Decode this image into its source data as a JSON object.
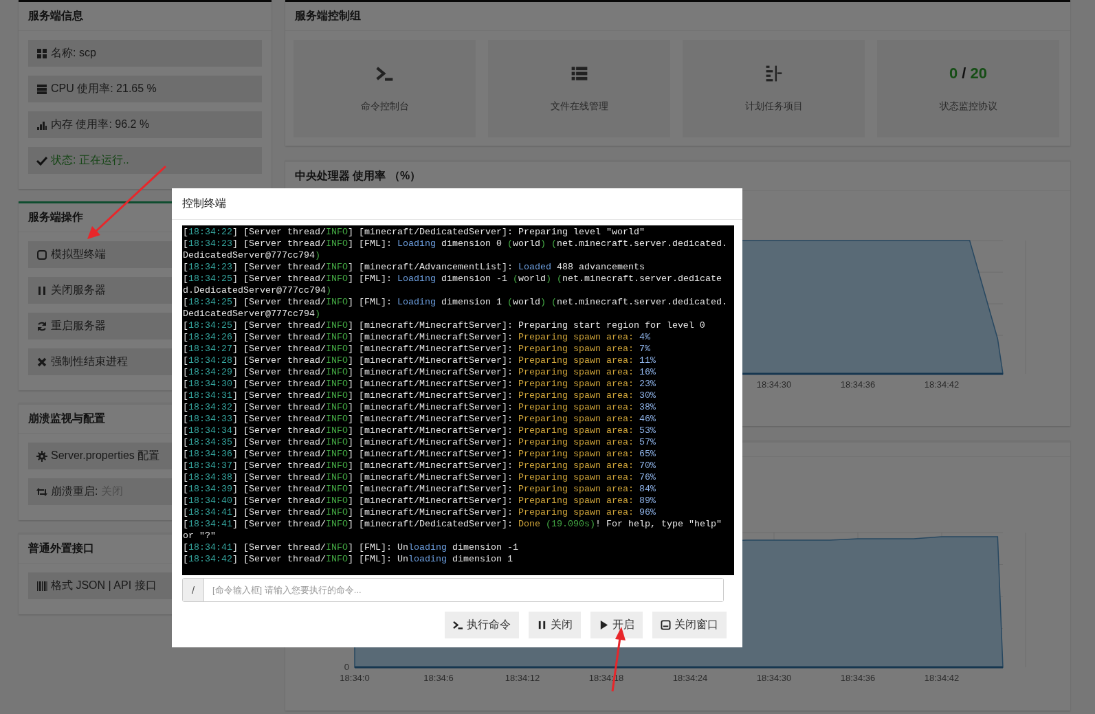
{
  "sidebar": {
    "panels": [
      {
        "title": "服务端信息",
        "items": [
          {
            "text": "名称: scp"
          },
          {
            "text": "CPU 使用率: 21.65 %"
          },
          {
            "text": "内存 使用率: 96.2 %"
          },
          {
            "text": "状态: 正在运行..",
            "kind": "status"
          }
        ]
      },
      {
        "title": "服务端操作",
        "items": [
          {
            "text": "模拟型终端"
          },
          {
            "text": "关闭服务器"
          },
          {
            "text": "重启服务器"
          },
          {
            "text": "强制性结束进程"
          }
        ]
      },
      {
        "title": "崩溃监视与配置",
        "items": [
          {
            "text": "Server.properties 配置"
          },
          {
            "text": "崩溃重启:",
            "value": "关闭"
          }
        ]
      },
      {
        "title": "普通外置接口",
        "items": [
          {
            "text": "格式 JSON | API 接口"
          }
        ]
      }
    ]
  },
  "control_group": {
    "title": "服务端控制组",
    "tiles": [
      {
        "kind": "icon",
        "label": "命令控制台"
      },
      {
        "kind": "icon",
        "label": "文件在线管理"
      },
      {
        "kind": "icon",
        "label": "计划任务项目"
      },
      {
        "kind": "counter",
        "current": "0",
        "separator": "/",
        "total": "20",
        "label": "状态监控协议"
      }
    ]
  },
  "cpu_chart": {
    "title": "中央处理器 使用率 （%）",
    "x_ticks": [
      "18:34:30",
      "18:34:36",
      "18:34:42"
    ]
  },
  "memory_chart": {
    "y_ticks": [
      "0"
    ],
    "x_ticks": [
      "18:34:0",
      "18:34:6",
      "18:34:12",
      "18:34:18",
      "18:34:24",
      "18:34:30",
      "18:34:36",
      "18:34:42"
    ]
  },
  "modal": {
    "title": "控制终端",
    "log_lines": [
      [
        {
          "text": "[",
          "kind": "plain"
        },
        {
          "text": "18:34:22",
          "kind": "time"
        },
        {
          "text": "] [Server thread/",
          "kind": "plain"
        },
        {
          "text": "INFO",
          "kind": "level"
        },
        {
          "text": "] [minecraft/DedicatedServer]: Preparing level \"world\"",
          "kind": "plain"
        }
      ],
      [
        {
          "text": "[",
          "kind": "plain"
        },
        {
          "text": "18:34:23",
          "kind": "time"
        },
        {
          "text": "] [Server thread/",
          "kind": "plain"
        },
        {
          "text": "INFO",
          "kind": "level"
        },
        {
          "text": "] [FML]: ",
          "kind": "plain"
        },
        {
          "text": "Loading",
          "kind": "keyword"
        },
        {
          "text": " dimension 0 ",
          "kind": "plain"
        },
        {
          "text": "(",
          "kind": "paren"
        },
        {
          "text": "world",
          "kind": "plain"
        },
        {
          "text": ") (",
          "kind": "paren"
        },
        {
          "text": "net.minecraft.server.dedicated.DedicatedServer@777cc794",
          "kind": "plain"
        },
        {
          "text": ")",
          "kind": "paren"
        }
      ],
      [
        {
          "text": "[",
          "kind": "plain"
        },
        {
          "text": "18:34:23",
          "kind": "time"
        },
        {
          "text": "] [Server thread/",
          "kind": "plain"
        },
        {
          "text": "INFO",
          "kind": "level"
        },
        {
          "text": "] [minecraft/AdvancementList]: ",
          "kind": "plain"
        },
        {
          "text": "Loaded",
          "kind": "keyword"
        },
        {
          "text": " 488 advancements",
          "kind": "plain"
        }
      ],
      [
        {
          "text": "[",
          "kind": "plain"
        },
        {
          "text": "18:34:25",
          "kind": "time"
        },
        {
          "text": "] [Server thread/",
          "kind": "plain"
        },
        {
          "text": "INFO",
          "kind": "level"
        },
        {
          "text": "] [FML]: ",
          "kind": "plain"
        },
        {
          "text": "Loading",
          "kind": "keyword"
        },
        {
          "text": " dimension -1 ",
          "kind": "plain"
        },
        {
          "text": "(",
          "kind": "paren"
        },
        {
          "text": "world",
          "kind": "plain"
        },
        {
          "text": ") (",
          "kind": "paren"
        },
        {
          "text": "net.minecraft.server.dedicated.DedicatedServer@777cc794",
          "kind": "plain"
        },
        {
          "text": ")",
          "kind": "paren"
        }
      ],
      [
        {
          "text": "[",
          "kind": "plain"
        },
        {
          "text": "18:34:25",
          "kind": "time"
        },
        {
          "text": "] [Server thread/",
          "kind": "plain"
        },
        {
          "text": "INFO",
          "kind": "level"
        },
        {
          "text": "] [FML]: ",
          "kind": "plain"
        },
        {
          "text": "Loading",
          "kind": "keyword"
        },
        {
          "text": " dimension 1 ",
          "kind": "plain"
        },
        {
          "text": "(",
          "kind": "paren"
        },
        {
          "text": "world",
          "kind": "plain"
        },
        {
          "text": ") (",
          "kind": "paren"
        },
        {
          "text": "net.minecraft.server.dedicated.DedicatedServer@777cc794",
          "kind": "plain"
        },
        {
          "text": ")",
          "kind": "paren"
        }
      ],
      [
        {
          "text": "[",
          "kind": "plain"
        },
        {
          "text": "18:34:25",
          "kind": "time"
        },
        {
          "text": "] [Server thread/",
          "kind": "plain"
        },
        {
          "text": "INFO",
          "kind": "level"
        },
        {
          "text": "] [minecraft/MinecraftServer]: Preparing start region for level 0",
          "kind": "plain"
        }
      ],
      [
        {
          "text": "[",
          "kind": "plain"
        },
        {
          "text": "18:34:26",
          "kind": "time"
        },
        {
          "text": "] [Server thread/",
          "kind": "plain"
        },
        {
          "text": "INFO",
          "kind": "level"
        },
        {
          "text": "] [minecraft/MinecraftServer]: ",
          "kind": "plain"
        },
        {
          "text": "Preparing spawn area:",
          "kind": "progress"
        },
        {
          "text": " 4%",
          "kind": "number"
        }
      ],
      [
        {
          "text": "[",
          "kind": "plain"
        },
        {
          "text": "18:34:27",
          "kind": "time"
        },
        {
          "text": "] [Server thread/",
          "kind": "plain"
        },
        {
          "text": "INFO",
          "kind": "level"
        },
        {
          "text": "] [minecraft/MinecraftServer]: ",
          "kind": "plain"
        },
        {
          "text": "Preparing spawn area:",
          "kind": "progress"
        },
        {
          "text": " 7%",
          "kind": "number"
        }
      ],
      [
        {
          "text": "[",
          "kind": "plain"
        },
        {
          "text": "18:34:28",
          "kind": "time"
        },
        {
          "text": "] [Server thread/",
          "kind": "plain"
        },
        {
          "text": "INFO",
          "kind": "level"
        },
        {
          "text": "] [minecraft/MinecraftServer]: ",
          "kind": "plain"
        },
        {
          "text": "Preparing spawn area:",
          "kind": "progress"
        },
        {
          "text": " 11%",
          "kind": "number"
        }
      ],
      [
        {
          "text": "[",
          "kind": "plain"
        },
        {
          "text": "18:34:29",
          "kind": "time"
        },
        {
          "text": "] [Server thread/",
          "kind": "plain"
        },
        {
          "text": "INFO",
          "kind": "level"
        },
        {
          "text": "] [minecraft/MinecraftServer]: ",
          "kind": "plain"
        },
        {
          "text": "Preparing spawn area:",
          "kind": "progress"
        },
        {
          "text": " 16%",
          "kind": "number"
        }
      ],
      [
        {
          "text": "[",
          "kind": "plain"
        },
        {
          "text": "18:34:30",
          "kind": "time"
        },
        {
          "text": "] [Server thread/",
          "kind": "plain"
        },
        {
          "text": "INFO",
          "kind": "level"
        },
        {
          "text": "] [minecraft/MinecraftServer]: ",
          "kind": "plain"
        },
        {
          "text": "Preparing spawn area:",
          "kind": "progress"
        },
        {
          "text": " 23%",
          "kind": "number"
        }
      ],
      [
        {
          "text": "[",
          "kind": "plain"
        },
        {
          "text": "18:34:31",
          "kind": "time"
        },
        {
          "text": "] [Server thread/",
          "kind": "plain"
        },
        {
          "text": "INFO",
          "kind": "level"
        },
        {
          "text": "] [minecraft/MinecraftServer]: ",
          "kind": "plain"
        },
        {
          "text": "Preparing spawn area:",
          "kind": "progress"
        },
        {
          "text": " 30%",
          "kind": "number"
        }
      ],
      [
        {
          "text": "[",
          "kind": "plain"
        },
        {
          "text": "18:34:32",
          "kind": "time"
        },
        {
          "text": "] [Server thread/",
          "kind": "plain"
        },
        {
          "text": "INFO",
          "kind": "level"
        },
        {
          "text": "] [minecraft/MinecraftServer]: ",
          "kind": "plain"
        },
        {
          "text": "Preparing spawn area:",
          "kind": "progress"
        },
        {
          "text": " 38%",
          "kind": "number"
        }
      ],
      [
        {
          "text": "[",
          "kind": "plain"
        },
        {
          "text": "18:34:33",
          "kind": "time"
        },
        {
          "text": "] [Server thread/",
          "kind": "plain"
        },
        {
          "text": "INFO",
          "kind": "level"
        },
        {
          "text": "] [minecraft/MinecraftServer]: ",
          "kind": "plain"
        },
        {
          "text": "Preparing spawn area:",
          "kind": "progress"
        },
        {
          "text": " 46%",
          "kind": "number"
        }
      ],
      [
        {
          "text": "[",
          "kind": "plain"
        },
        {
          "text": "18:34:34",
          "kind": "time"
        },
        {
          "text": "] [Server thread/",
          "kind": "plain"
        },
        {
          "text": "INFO",
          "kind": "level"
        },
        {
          "text": "] [minecraft/MinecraftServer]: ",
          "kind": "plain"
        },
        {
          "text": "Preparing spawn area:",
          "kind": "progress"
        },
        {
          "text": " 53%",
          "kind": "number"
        }
      ],
      [
        {
          "text": "[",
          "kind": "plain"
        },
        {
          "text": "18:34:35",
          "kind": "time"
        },
        {
          "text": "] [Server thread/",
          "kind": "plain"
        },
        {
          "text": "INFO",
          "kind": "level"
        },
        {
          "text": "] [minecraft/MinecraftServer]: ",
          "kind": "plain"
        },
        {
          "text": "Preparing spawn area:",
          "kind": "progress"
        },
        {
          "text": " 57%",
          "kind": "number"
        }
      ],
      [
        {
          "text": "[",
          "kind": "plain"
        },
        {
          "text": "18:34:36",
          "kind": "time"
        },
        {
          "text": "] [Server thread/",
          "kind": "plain"
        },
        {
          "text": "INFO",
          "kind": "level"
        },
        {
          "text": "] [minecraft/MinecraftServer]: ",
          "kind": "plain"
        },
        {
          "text": "Preparing spawn area:",
          "kind": "progress"
        },
        {
          "text": " 65%",
          "kind": "number"
        }
      ],
      [
        {
          "text": "[",
          "kind": "plain"
        },
        {
          "text": "18:34:37",
          "kind": "time"
        },
        {
          "text": "] [Server thread/",
          "kind": "plain"
        },
        {
          "text": "INFO",
          "kind": "level"
        },
        {
          "text": "] [minecraft/MinecraftServer]: ",
          "kind": "plain"
        },
        {
          "text": "Preparing spawn area:",
          "kind": "progress"
        },
        {
          "text": " 70%",
          "kind": "number"
        }
      ],
      [
        {
          "text": "[",
          "kind": "plain"
        },
        {
          "text": "18:34:38",
          "kind": "time"
        },
        {
          "text": "] [Server thread/",
          "kind": "plain"
        },
        {
          "text": "INFO",
          "kind": "level"
        },
        {
          "text": "] [minecraft/MinecraftServer]: ",
          "kind": "plain"
        },
        {
          "text": "Preparing spawn area:",
          "kind": "progress"
        },
        {
          "text": " 76%",
          "kind": "number"
        }
      ],
      [
        {
          "text": "[",
          "kind": "plain"
        },
        {
          "text": "18:34:39",
          "kind": "time"
        },
        {
          "text": "] [Server thread/",
          "kind": "plain"
        },
        {
          "text": "INFO",
          "kind": "level"
        },
        {
          "text": "] [minecraft/MinecraftServer]: ",
          "kind": "plain"
        },
        {
          "text": "Preparing spawn area:",
          "kind": "progress"
        },
        {
          "text": " 84%",
          "kind": "number"
        }
      ],
      [
        {
          "text": "[",
          "kind": "plain"
        },
        {
          "text": "18:34:40",
          "kind": "time"
        },
        {
          "text": "] [Server thread/",
          "kind": "plain"
        },
        {
          "text": "INFO",
          "kind": "level"
        },
        {
          "text": "] [minecraft/MinecraftServer]: ",
          "kind": "plain"
        },
        {
          "text": "Preparing spawn area:",
          "kind": "progress"
        },
        {
          "text": " 89%",
          "kind": "number"
        }
      ],
      [
        {
          "text": "[",
          "kind": "plain"
        },
        {
          "text": "18:34:41",
          "kind": "time"
        },
        {
          "text": "] [Server thread/",
          "kind": "plain"
        },
        {
          "text": "INFO",
          "kind": "level"
        },
        {
          "text": "] [minecraft/MinecraftServer]: ",
          "kind": "plain"
        },
        {
          "text": "Preparing spawn area:",
          "kind": "progress"
        },
        {
          "text": " 96%",
          "kind": "number"
        }
      ],
      [
        {
          "text": "[",
          "kind": "plain"
        },
        {
          "text": "18:34:41",
          "kind": "time"
        },
        {
          "text": "] [Server thread/",
          "kind": "plain"
        },
        {
          "text": "INFO",
          "kind": "level"
        },
        {
          "text": "] [minecraft/DedicatedServer]: ",
          "kind": "plain"
        },
        {
          "text": "Done",
          "kind": "progress"
        },
        {
          "text": " (19.090s)",
          "kind": "paren"
        },
        {
          "text": "! For help, type \"help\" or \"?\"",
          "kind": "plain"
        }
      ],
      [
        {
          "text": "[",
          "kind": "plain"
        },
        {
          "text": "18:34:41",
          "kind": "time"
        },
        {
          "text": "] [Server thread/",
          "kind": "plain"
        },
        {
          "text": "INFO",
          "kind": "level"
        },
        {
          "text": "] [FML]: Un",
          "kind": "plain"
        },
        {
          "text": "loading",
          "kind": "keyword"
        },
        {
          "text": " dimension -1",
          "kind": "plain"
        }
      ],
      [
        {
          "text": "[",
          "kind": "plain"
        },
        {
          "text": "18:34:42",
          "kind": "time"
        },
        {
          "text": "] [Server thread/",
          "kind": "plain"
        },
        {
          "text": "INFO",
          "kind": "level"
        },
        {
          "text": "] [FML]: Un",
          "kind": "plain"
        },
        {
          "text": "loading",
          "kind": "keyword"
        },
        {
          "text": " dimension 1",
          "kind": "plain"
        }
      ]
    ],
    "command_prefix": "/",
    "command_placeholder": "[命令输入框] 请输入您要执行的命令...",
    "buttons": [
      {
        "label": "执行命令"
      },
      {
        "label": "关闭"
      },
      {
        "label": "开启"
      },
      {
        "label": "关闭窗口"
      }
    ]
  }
}
